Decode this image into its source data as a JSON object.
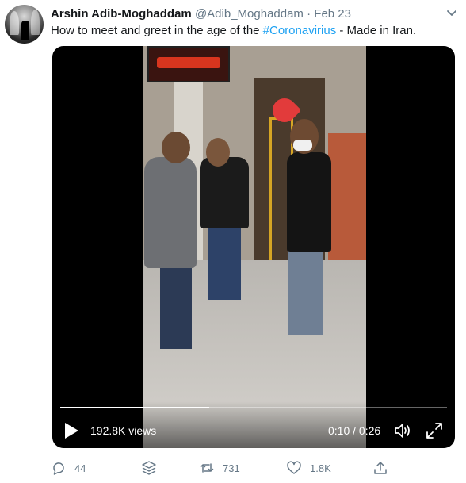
{
  "tweet": {
    "author_name": "Arshin Adib-Moghaddam",
    "handle": "@Adib_Moghaddam",
    "separator": "·",
    "date": "Feb 23",
    "text_before": "How to meet and greet in the age of the ",
    "hashtag": "#Coronavirius",
    "text_after": " - Made in Iran.",
    "hashtag_color": "#1da1f2"
  },
  "video": {
    "views": "192.8K views",
    "time": "0:10 / 0:26",
    "progress": 0.385
  },
  "actions": {
    "reply_count": "44",
    "retweet_count": "731",
    "like_count": "1.8K"
  },
  "icons": [
    "chevron-down-icon",
    "play-icon",
    "volume-icon",
    "fullscreen-icon",
    "reply-icon",
    "stack-icon",
    "retweet-icon",
    "like-icon",
    "share-icon"
  ],
  "colors": {
    "text": "#14171a",
    "muted": "#657786",
    "accent": "#1da1f2"
  }
}
